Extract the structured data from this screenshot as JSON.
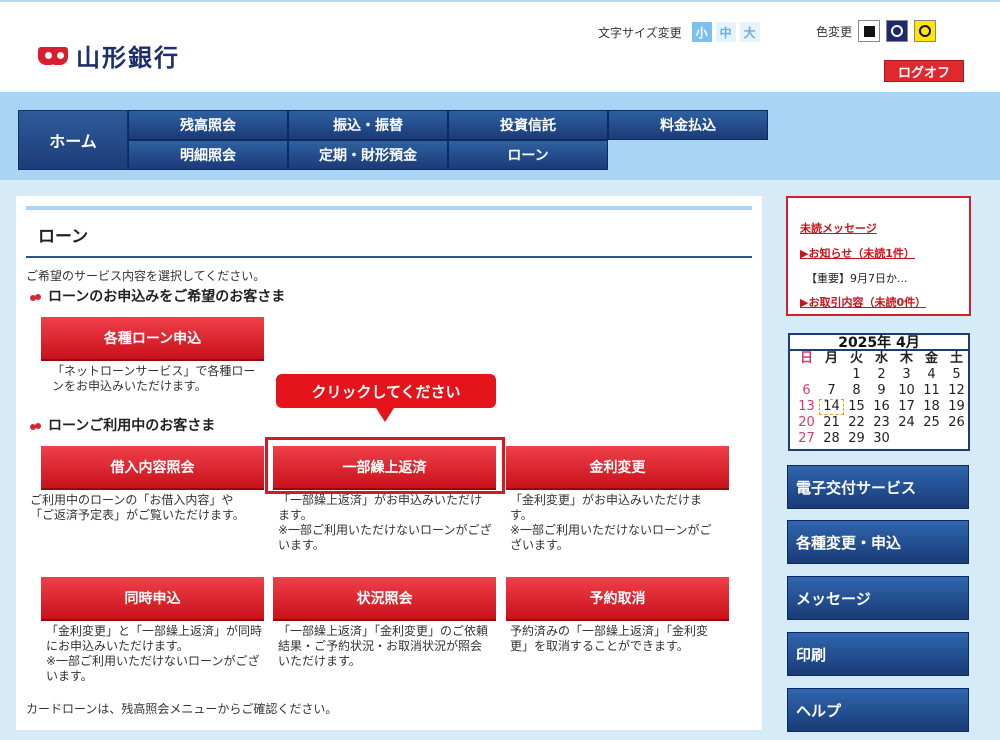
{
  "header": {
    "bank_name": "山形銀行",
    "font_size_label": "文字サイズ変更",
    "font_sizes": [
      "小",
      "中",
      "大"
    ],
    "color_change_label": "色変更",
    "logoff_label": "ログオフ"
  },
  "nav": {
    "home": "ホーム",
    "items": [
      "残高照会",
      "振込・振替",
      "投資信託",
      "料金払込",
      "明細照会",
      "定期・財形預金",
      "ローン"
    ]
  },
  "main": {
    "title": "ローン",
    "intro": "ご希望のサービス内容を選択してください。",
    "section1_title": "ローンのお申込みをご希望のお客さま",
    "section2_title": "ローンご利用中のお客さま",
    "apply_button": "各種ローン申込",
    "apply_desc": "「ネットローンサービス」で各種ローンをお申込みいただけます。",
    "buttons": [
      {
        "label": "借入内容照会",
        "desc": "ご利用中のローンの「お借入内容」や「ご返済予定表」がご覧いただけます。"
      },
      {
        "label": "一部繰上返済",
        "desc": "「一部繰上返済」がお申込みいただけます。\n※一部ご利用いただけないローンがございます。"
      },
      {
        "label": "金利変更",
        "desc": "「金利変更」がお申込みいただけます。\n※一部ご利用いただけないローンがございます。"
      },
      {
        "label": "同時申込",
        "desc": "「金利変更」と「一部繰上返済」が同時にお申込みいただけます。\n※一部ご利用いただけないローンがございます。"
      },
      {
        "label": "状況照会",
        "desc": "「一部繰上返済」「金利変更」のご依頼結果・ご予約状況・お取消状況が照会いただけます。"
      },
      {
        "label": "予約取消",
        "desc": "予約済みの「一部繰上返済」「金利変更」を取消することができます。"
      }
    ],
    "footer_note": "カードローンは、残高照会メニューからご確認ください。",
    "callout": "クリックしてください"
  },
  "sidebar": {
    "messages": {
      "unread": "未読メッセージ",
      "notice": "▶お知らせ（未読1件）",
      "notice_item": "【重要】9月7日か...",
      "transaction": "▶お取引内容（未読0件）"
    },
    "calendar": {
      "title": "2025年 4月",
      "weekdays": [
        "日",
        "月",
        "火",
        "水",
        "木",
        "金",
        "土"
      ],
      "days": [
        "",
        "",
        "1",
        "2",
        "3",
        "4",
        "5",
        "6",
        "7",
        "8",
        "9",
        "10",
        "11",
        "12",
        "13",
        "14",
        "15",
        "16",
        "17",
        "18",
        "19",
        "20",
        "21",
        "22",
        "23",
        "24",
        "25",
        "26",
        "27",
        "28",
        "29",
        "30"
      ],
      "today": "14"
    },
    "buttons": [
      "電子交付サービス",
      "各種変更・申込",
      "メッセージ",
      "印刷",
      "ヘルプ"
    ]
  }
}
